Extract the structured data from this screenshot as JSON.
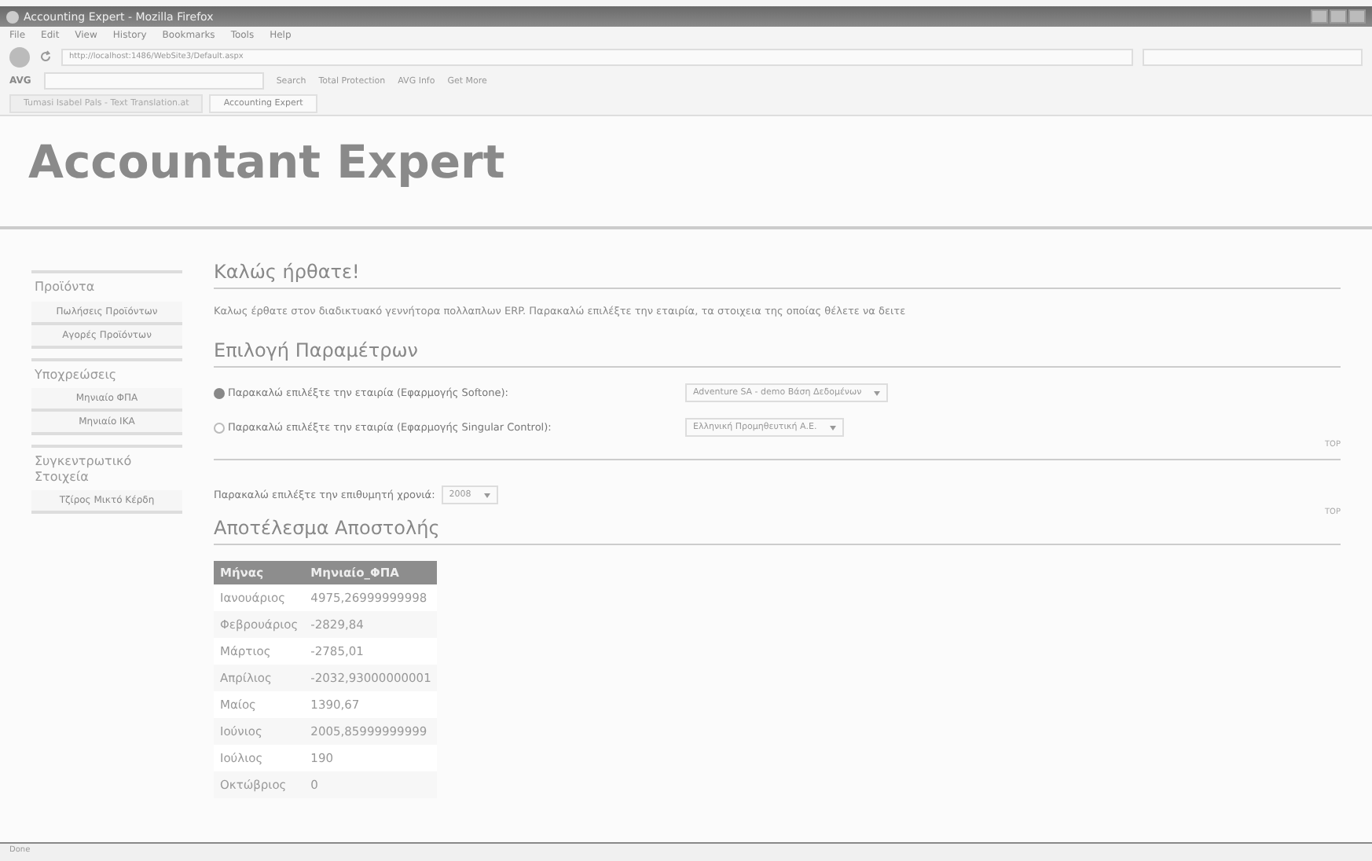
{
  "window": {
    "title": "Accounting Expert - Mozilla Firefox"
  },
  "menu": [
    "File",
    "Edit",
    "View",
    "History",
    "Bookmarks",
    "Tools",
    "Help"
  ],
  "address_bar": {
    "value": "http://localhost:1486/WebSite3/Default.aspx"
  },
  "toolbar": {
    "brand": "AVG",
    "items": [
      "Search",
      "Total Protection",
      "AVG Info",
      "Get More"
    ]
  },
  "tabs": [
    {
      "label": "Tumasi Isabel Pals - Text Translation.at",
      "selected": false
    },
    {
      "label": "Accounting Expert",
      "selected": true
    }
  ],
  "site_title": "Accountant Expert",
  "sidebar": {
    "items": [
      {
        "kind": "header",
        "label": "Προϊόντα"
      },
      {
        "kind": "link",
        "label": "Πωλήσεις Προϊόντων"
      },
      {
        "kind": "link",
        "label": "Αγορές Προϊόντων"
      },
      {
        "kind": "header",
        "label": "Υποχρεώσεις"
      },
      {
        "kind": "link",
        "label": "Μηνιαίο ΦΠΑ"
      },
      {
        "kind": "link",
        "label": "Μηνιαίο ΙΚΑ"
      },
      {
        "kind": "header",
        "label": "Συγκεντρωτικό Στοιχεία"
      },
      {
        "kind": "link",
        "label": "Τζίρος Μικτό Κέρδη"
      }
    ]
  },
  "welcome": {
    "heading": "Καλώς ήρθατε!",
    "text": "Καλως έρθατε στον διαδικτυακό γεννήτορα πολλαπλων ERP. Παρακαλώ επιλέξτε την εταιρία,  τα στοιχεια της οποίας θέλετε να δειτε"
  },
  "parameters": {
    "heading": "Επιλογή Παραμέτρων",
    "options": [
      {
        "label": "Παρακαλώ επιλέξτε την εταιρία (Εφαρμογής Softone):",
        "selected": true,
        "value": "Adventure SA - demo Βάση Δεδομένων"
      },
      {
        "label": "Παρακαλώ επιλέξτε την εταιρία (Εφαρμογής Singular Control):",
        "selected": false,
        "value": "Ελληνική Προμηθευτική Α.Ε."
      }
    ],
    "top_link": "TOP",
    "year_label": "Παρακαλώ επιλέξτε την επιθυμητή χρονιά:",
    "year": "2008"
  },
  "results": {
    "heading": "Αποτέλεσμα Αποστολής",
    "top_link": "TOP",
    "table": {
      "columns": [
        "Μήνας",
        "Μηνιαίο_ΦΠΑ"
      ],
      "rows": [
        [
          "Ιανουάριος",
          "4975,26999999998"
        ],
        [
          "Φεβρουάριος",
          "-2829,84"
        ],
        [
          "Μάρτιος",
          "-2785,01"
        ],
        [
          "Απρίλιος",
          "-2032,93000000001"
        ],
        [
          "Μαίος",
          "1390,67"
        ],
        [
          "Ιούνιος",
          "2005,85999999999"
        ],
        [
          "Ιούλιος",
          "190"
        ],
        [
          "Οκτώβριος",
          "0"
        ]
      ]
    }
  },
  "status_bar": "Done"
}
